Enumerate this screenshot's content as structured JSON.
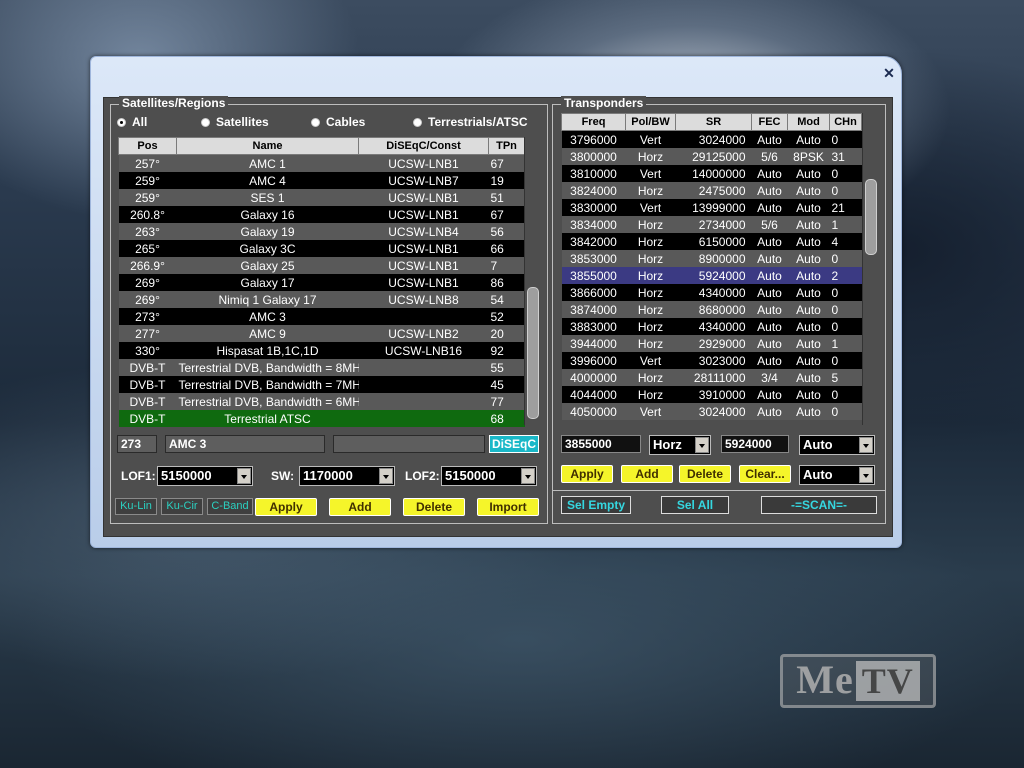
{
  "watermark": {
    "me": "Me",
    "tv": "TV"
  },
  "window": {
    "close_glyph": "✕"
  },
  "satellites": {
    "group_title": "Satellites/Regions",
    "filters": [
      {
        "label": "All",
        "selected": true
      },
      {
        "label": "Satellites",
        "selected": false
      },
      {
        "label": "Cables",
        "selected": false
      },
      {
        "label": "Terrestrials/ATSC",
        "selected": false
      }
    ],
    "columns": [
      "Pos",
      "Name",
      "DiSEqC/Const",
      "TPn"
    ],
    "rows": [
      {
        "pos": "257°",
        "name": "AMC 1",
        "diseqc": "UCSW-LNB1",
        "tpn": "67",
        "style": "even"
      },
      {
        "pos": "259°",
        "name": "AMC 4",
        "diseqc": "UCSW-LNB7",
        "tpn": "19",
        "style": "odd"
      },
      {
        "pos": "259°",
        "name": "SES 1",
        "diseqc": "UCSW-LNB1",
        "tpn": "51",
        "style": "even"
      },
      {
        "pos": "260.8°",
        "name": "Galaxy 16",
        "diseqc": "UCSW-LNB1",
        "tpn": "67",
        "style": "odd"
      },
      {
        "pos": "263°",
        "name": "Galaxy 19",
        "diseqc": "UCSW-LNB4",
        "tpn": "56",
        "style": "even"
      },
      {
        "pos": "265°",
        "name": "Galaxy 3C",
        "diseqc": "UCSW-LNB1",
        "tpn": "66",
        "style": "odd"
      },
      {
        "pos": "266.9°",
        "name": "Galaxy 25",
        "diseqc": "UCSW-LNB1",
        "tpn": "7",
        "style": "even"
      },
      {
        "pos": "269°",
        "name": "Galaxy 17",
        "diseqc": "UCSW-LNB1",
        "tpn": "86",
        "style": "odd"
      },
      {
        "pos": "269°",
        "name": "Nimiq 1   Galaxy 17",
        "diseqc": "UCSW-LNB8",
        "tpn": "54",
        "style": "even"
      },
      {
        "pos": "273°",
        "name": "AMC 3",
        "diseqc": "",
        "tpn": "52",
        "style": "odd"
      },
      {
        "pos": "277°",
        "name": "AMC 9",
        "diseqc": "UCSW-LNB2",
        "tpn": "20",
        "style": "even"
      },
      {
        "pos": "330°",
        "name": "Hispasat 1B,1C,1D",
        "diseqc": "UCSW-LNB16",
        "tpn": "92",
        "style": "odd"
      },
      {
        "pos": "DVB-T",
        "name": "Terrestrial DVB, Bandwidth = 8MH",
        "diseqc": "",
        "tpn": "55",
        "style": "even"
      },
      {
        "pos": "DVB-T",
        "name": "Terrestrial DVB, Bandwidth = 7MH",
        "diseqc": "",
        "tpn": "45",
        "style": "odd"
      },
      {
        "pos": "DVB-T",
        "name": "Terrestrial DVB, Bandwidth = 6MH",
        "diseqc": "",
        "tpn": "77",
        "style": "even"
      },
      {
        "pos": "DVB-T",
        "name": "Terrestrial ATSC",
        "diseqc": "",
        "tpn": "68",
        "style": "green"
      }
    ],
    "edit": {
      "pos_value": "273",
      "name_value": "AMC 3",
      "const_value": "",
      "diseqc_button": "DiSEqC"
    },
    "lof1": {
      "label": "LOF1:",
      "value": "5150000"
    },
    "sw": {
      "label": "SW:",
      "value": "1170000"
    },
    "lof2": {
      "label": "LOF2:",
      "value": "5150000"
    },
    "band_buttons": [
      "Ku-Lin",
      "Ku-Cir",
      "C-Band"
    ],
    "actions": [
      "Apply",
      "Add",
      "Delete",
      "Import"
    ]
  },
  "transponders": {
    "group_title": "Transponders",
    "columns": [
      "Freq",
      "Pol/BW",
      "SR",
      "FEC",
      "Mod",
      "CHn"
    ],
    "rows": [
      {
        "freq": "3796000",
        "pol": "Vert",
        "sr": "3024000",
        "fec": "Auto",
        "mod": "Auto",
        "chn": "0",
        "style": "odd"
      },
      {
        "freq": "3800000",
        "pol": "Horz",
        "sr": "29125000",
        "fec": "5/6",
        "mod": "8PSK",
        "chn": "31",
        "style": "even"
      },
      {
        "freq": "3810000",
        "pol": "Vert",
        "sr": "14000000",
        "fec": "Auto",
        "mod": "Auto",
        "chn": "0",
        "style": "odd"
      },
      {
        "freq": "3824000",
        "pol": "Horz",
        "sr": "2475000",
        "fec": "Auto",
        "mod": "Auto",
        "chn": "0",
        "style": "even"
      },
      {
        "freq": "3830000",
        "pol": "Vert",
        "sr": "13999000",
        "fec": "Auto",
        "mod": "Auto",
        "chn": "21",
        "style": "odd"
      },
      {
        "freq": "3834000",
        "pol": "Horz",
        "sr": "2734000",
        "fec": "5/6",
        "mod": "Auto",
        "chn": "1",
        "style": "even"
      },
      {
        "freq": "3842000",
        "pol": "Horz",
        "sr": "6150000",
        "fec": "Auto",
        "mod": "Auto",
        "chn": "4",
        "style": "odd"
      },
      {
        "freq": "3853000",
        "pol": "Horz",
        "sr": "8900000",
        "fec": "Auto",
        "mod": "Auto",
        "chn": "0",
        "style": "even"
      },
      {
        "freq": "3855000",
        "pol": "Horz",
        "sr": "5924000",
        "fec": "Auto",
        "mod": "Auto",
        "chn": "2",
        "style": "sel"
      },
      {
        "freq": "3866000",
        "pol": "Horz",
        "sr": "4340000",
        "fec": "Auto",
        "mod": "Auto",
        "chn": "0",
        "style": "odd"
      },
      {
        "freq": "3874000",
        "pol": "Horz",
        "sr": "8680000",
        "fec": "Auto",
        "mod": "Auto",
        "chn": "0",
        "style": "even"
      },
      {
        "freq": "3883000",
        "pol": "Horz",
        "sr": "4340000",
        "fec": "Auto",
        "mod": "Auto",
        "chn": "0",
        "style": "odd"
      },
      {
        "freq": "3944000",
        "pol": "Horz",
        "sr": "2929000",
        "fec": "Auto",
        "mod": "Auto",
        "chn": "1",
        "style": "even"
      },
      {
        "freq": "3996000",
        "pol": "Vert",
        "sr": "3023000",
        "fec": "Auto",
        "mod": "Auto",
        "chn": "0",
        "style": "odd"
      },
      {
        "freq": "4000000",
        "pol": "Horz",
        "sr": "28111000",
        "fec": "3/4",
        "mod": "Auto",
        "chn": "5",
        "style": "even"
      },
      {
        "freq": "4044000",
        "pol": "Horz",
        "sr": "3910000",
        "fec": "Auto",
        "mod": "Auto",
        "chn": "0",
        "style": "odd"
      },
      {
        "freq": "4050000",
        "pol": "Vert",
        "sr": "3024000",
        "fec": "Auto",
        "mod": "Auto",
        "chn": "0",
        "style": "even"
      }
    ],
    "edit": {
      "freq_value": "3855000",
      "pol_value": "Horz",
      "sr_value": "5924000",
      "fec_value": "Auto",
      "mod_value": "Auto"
    },
    "actions": [
      "Apply",
      "Add",
      "Delete",
      "Clear..."
    ],
    "bottom_buttons": [
      "Sel Empty",
      "Sel All",
      "-=SCAN=-"
    ]
  }
}
